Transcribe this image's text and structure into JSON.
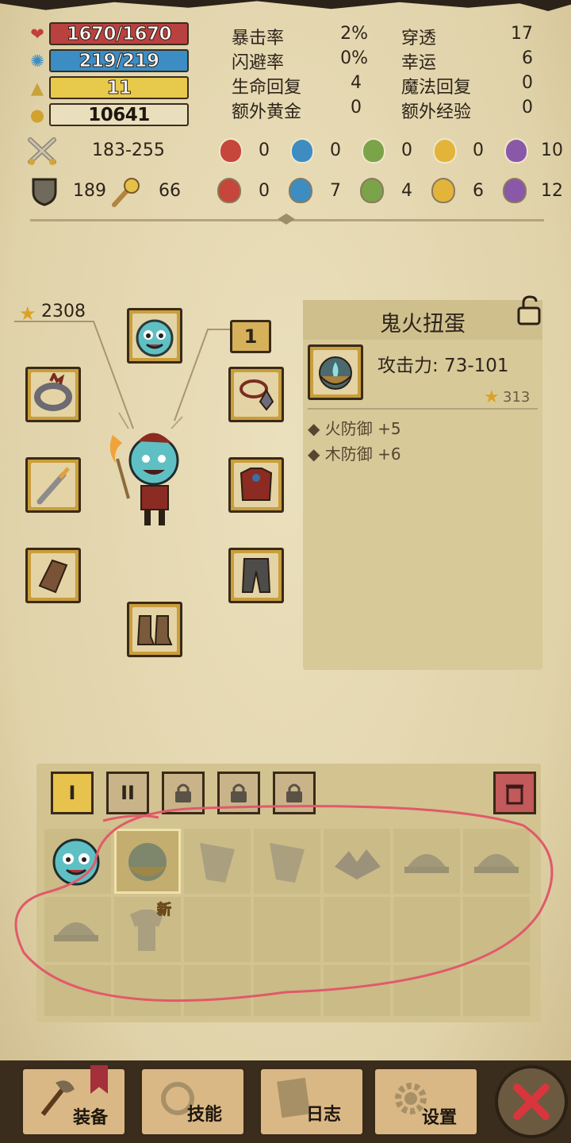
{
  "resources": {
    "hp": "1670/1670",
    "mp": "219/219",
    "level": "11",
    "gold": "10641"
  },
  "stats": {
    "crit_label": "暴击率",
    "crit_value": "2%",
    "dodge_label": "闪避率",
    "dodge_value": "0%",
    "hp_regen_label": "生命回复",
    "hp_regen_value": "4",
    "extra_gold_label": "额外黄金",
    "extra_gold_value": "0",
    "pierce_label": "穿透",
    "pierce_value": "17",
    "luck_label": "幸运",
    "luck_value": "6",
    "mp_regen_label": "魔法回复",
    "mp_regen_value": "0",
    "extra_exp_label": "额外经验",
    "extra_exp_value": "0"
  },
  "combat": {
    "attack": "183-255",
    "defense": "189",
    "magic": "66",
    "element_attack": [
      "0",
      "0",
      "0",
      "0",
      "10"
    ],
    "element_defense": [
      "0",
      "7",
      "4",
      "6",
      "12"
    ]
  },
  "equipment": {
    "total_score": "2308",
    "pet_level": "1"
  },
  "detail": {
    "title": "鬼火扭蛋",
    "attack": "攻击力: 73-101",
    "score": "313",
    "bonus1": "火防御 +5",
    "bonus2": "木防御 +6"
  },
  "inventory": {
    "tabs": [
      "I",
      "II"
    ],
    "new_badge": "新"
  },
  "nav": {
    "equip": "装备",
    "skills": "技能",
    "log": "日志",
    "settings": "设置"
  },
  "colors": {
    "hp": "#b94240",
    "mp": "#3b8dc4",
    "level": "#e7c94c",
    "annotation": "#e05a6a"
  }
}
